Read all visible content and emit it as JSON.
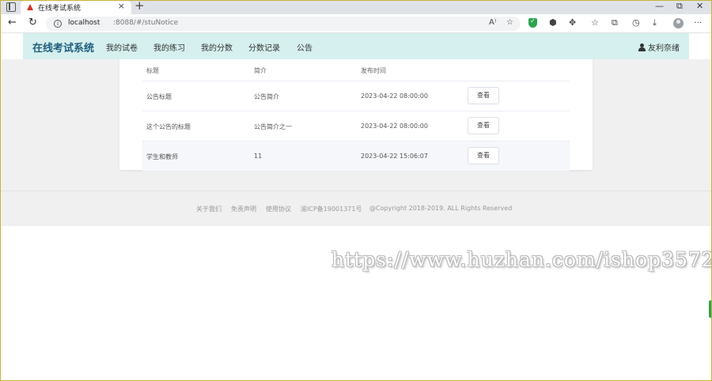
{
  "browser": {
    "tab_title": "在线考试系统",
    "tab_close": "×",
    "new_tab": "+",
    "window_controls": [
      "—",
      "⧉",
      "✕"
    ],
    "url_host": "localhost",
    "url_path": ":8088/#/stuNotice",
    "back_icon": "←",
    "refresh_icon": "↻",
    "read_aloud_icon": "A⁾",
    "favorite_icon": "☆",
    "more_icon": "···"
  },
  "header": {
    "logo": "在线考试系统",
    "nav": [
      "我的试卷",
      "我的练习",
      "我的分数",
      "分数记录",
      "公告"
    ],
    "user_name": "友利奈绪"
  },
  "table": {
    "columns": [
      "标题",
      "简介",
      "发布时间"
    ],
    "rows": [
      {
        "title": "公告标题",
        "intro": "公告简介",
        "time": "2023-04-22 08:00:00",
        "action": "查看"
      },
      {
        "title": "这个公告的标题",
        "intro": "公告简介之一",
        "time": "2023-04-22 08:00:00",
        "action": "查看"
      },
      {
        "title": "学生和教师",
        "intro": "11",
        "time": "2023-04-22 15:06:07",
        "action": "查看"
      }
    ]
  },
  "footer": {
    "links": [
      "关于我们",
      "免责声明",
      "使用协议",
      "渝ICP备19001371号",
      "@Copyright 2018-2019. ALL Rights Reserved"
    ]
  },
  "watermark": "https://www.huzhan.com/ishop3572"
}
